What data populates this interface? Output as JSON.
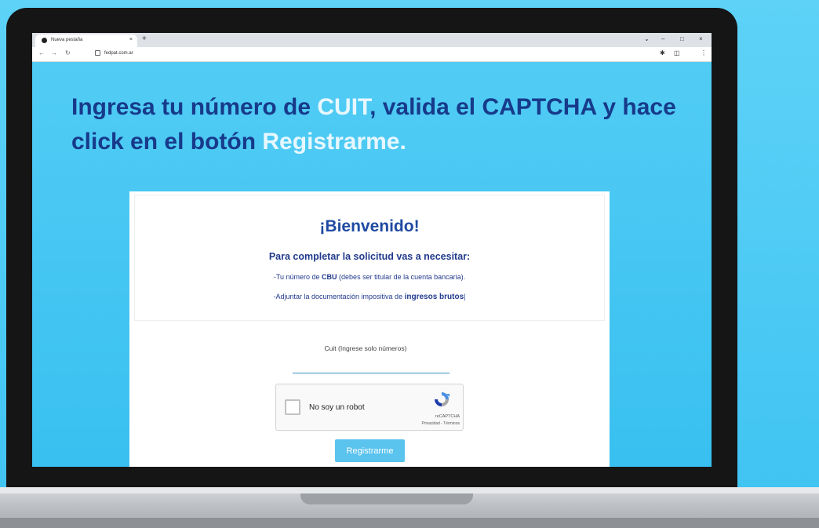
{
  "browser": {
    "tab_title": "Nueva pestaña",
    "tab_close": "×",
    "new_tab": "+",
    "url": "fedpat.com.ar",
    "win_controls": [
      "⌄",
      "–",
      "□",
      "×"
    ]
  },
  "headline": {
    "part1": "Ingresa tu número de ",
    "cuit": "CUIT",
    "part2": ", valida el CAPTCHA y hace click en el botón ",
    "registrarme": "Registrarme."
  },
  "card": {
    "welcome": "¡Bienvenido!",
    "need": "Para completar la solicitud vas a necesitar:",
    "req1_a": "-Tu número de ",
    "req1_b": "CBU",
    "req1_c": " (debes ser titular de la cuenta bancaria).",
    "req2_a": "-Adjuntar la documentación impositiva de ",
    "req2_b": "ingresos brutos"
  },
  "form": {
    "cuit_label": "Cuit (Ingrese solo números)",
    "captcha_label": "No soy un robot",
    "captcha_brand": "reCAPTCHA",
    "captcha_links": "Privacidad - Términos",
    "submit": "Registrarme"
  }
}
